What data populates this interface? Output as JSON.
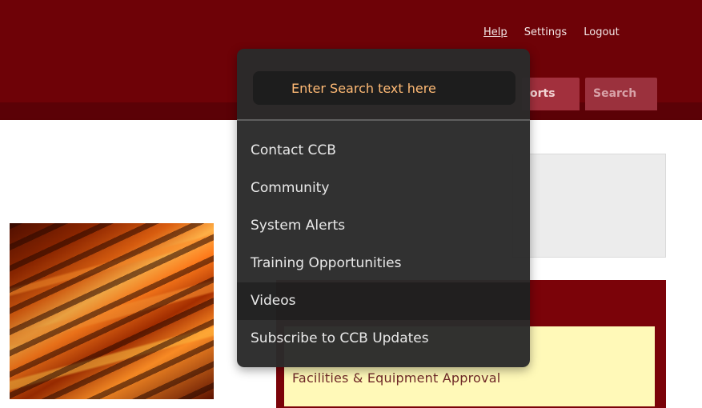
{
  "header": {
    "links": [
      {
        "label": "Help"
      },
      {
        "label": "Settings"
      },
      {
        "label": "Logout"
      }
    ],
    "tabs": [
      {
        "label": "orts"
      },
      {
        "label": "Search"
      }
    ]
  },
  "dropdown": {
    "search_placeholder": "Enter Search text here",
    "items": [
      {
        "label": "Contact CCB"
      },
      {
        "label": "Community"
      },
      {
        "label": "System Alerts"
      },
      {
        "label": "Training Opportunities"
      },
      {
        "label": "Videos"
      },
      {
        "label": "Subscribe to CCB Updates"
      }
    ]
  },
  "content": {
    "yellow_text": "Facilities & Equipment Approval"
  },
  "colors": {
    "header_bg": "#6e0207",
    "dropdown_bg": "#2a2a2a",
    "accent_orange": "#ffba75",
    "panel_yellow": "#fff9b8"
  }
}
